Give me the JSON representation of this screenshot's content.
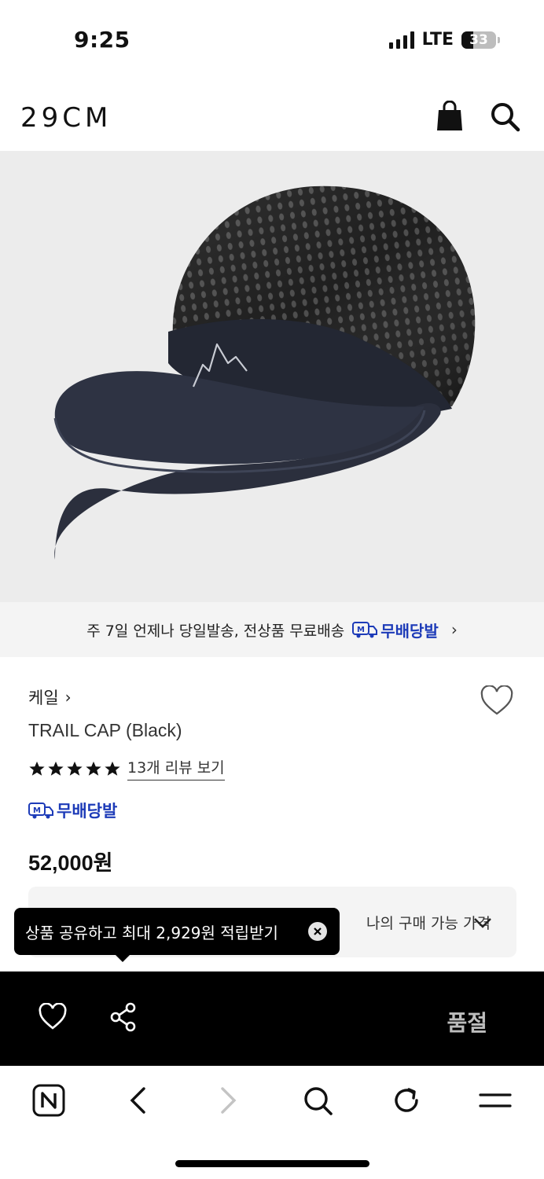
{
  "status_bar": {
    "time": "9:25",
    "network": "LTE",
    "battery": "33"
  },
  "header": {
    "logo": "29CM",
    "icons": [
      "shopping-bag-icon",
      "search-icon"
    ]
  },
  "shipping_banner": {
    "text": "주 7일 언제나 당일발송, 전상품 무료배송",
    "badge_label": "무배당발",
    "badge_icon": "M"
  },
  "product": {
    "brand": "케일",
    "name": "TRAIL CAP (Black)",
    "rating_stars": 5,
    "review_link": "13개 리뷰 보기",
    "badge_label": "무배당발",
    "price": "52,000원",
    "my_price_label": "나의 구매 가능 가격"
  },
  "tooltip": {
    "text": "상품 공유하고 최대 2,929원 적립받기"
  },
  "buy_bar": {
    "soldout_label": "품절"
  },
  "browser_toolbar": {
    "icons": [
      "naver-home-icon",
      "back-icon",
      "forward-icon",
      "search-icon",
      "reload-icon",
      "menu-icon"
    ]
  },
  "colors": {
    "accent_blue": "#1d3bb8",
    "hero_bg": "#ececec",
    "buy_bar_bg": "#000000",
    "soldout_text": "#bdbdbd"
  }
}
